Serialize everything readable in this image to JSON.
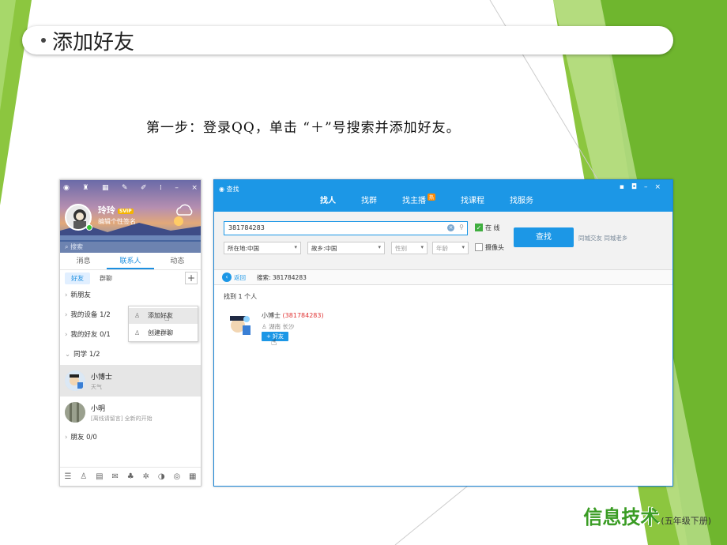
{
  "slide": {
    "title": "添加好友",
    "step_text": "第一步：登录QQ，单击 “＋”号搜索并添加好友。",
    "footer_logo": "信息技术",
    "footer_sub": "(五年级下册)"
  },
  "qq_panel": {
    "user_name": "玲玲",
    "user_badge": "SVIP",
    "signature": "编辑个性签名",
    "search_placeholder": "搜索",
    "tabs": [
      "消息",
      "联系人",
      "动态"
    ],
    "active_tab": "联系人",
    "sub_tabs": [
      "好友",
      "群聊"
    ],
    "plus_label": "+",
    "groups": [
      {
        "label": "新朋友",
        "arrow": "›"
      },
      {
        "label": "我的设备 1/2",
        "arrow": "›"
      },
      {
        "label": "我的好友 0/1",
        "arrow": "›"
      },
      {
        "label": "同学 1/2",
        "arrow": "⌄"
      }
    ],
    "contacts": [
      {
        "name": "小博士",
        "status": "天气"
      },
      {
        "name": "小明",
        "status": "[离线请留言] 全新的开始"
      }
    ],
    "last_group": {
      "label": "朋友 0/0",
      "arrow": "›"
    },
    "menu": [
      "添加好友",
      "创建群聊"
    ],
    "bottom_icons": [
      "menu-icon",
      "add-contact-icon",
      "file-icon",
      "mail-icon",
      "game-icon",
      "star-icon",
      "music-icon",
      "qzone-icon",
      "apps-icon"
    ]
  },
  "search_window": {
    "title": "查找",
    "tabs": [
      "找人",
      "找群",
      "找主播",
      "找课程",
      "找服务"
    ],
    "hot_badge": "热",
    "active_tab": "找人",
    "query": "381784283",
    "online_label": "在 线",
    "camera_label": "摄像头",
    "location_select": "所在地:中国",
    "hometown_select": "故乡:中国",
    "gender_placeholder": "性别",
    "age_placeholder": "年龄",
    "search_button": "查找",
    "links": "同城交友  同城老乡",
    "back_label": "返回",
    "breadcrumb": "搜索:  381784283",
    "result_count": "找到 1 个人",
    "result": {
      "name": "小博士",
      "qq": "(381784283)",
      "location": "湖南 长沙",
      "add_button": "+ 好友"
    }
  }
}
